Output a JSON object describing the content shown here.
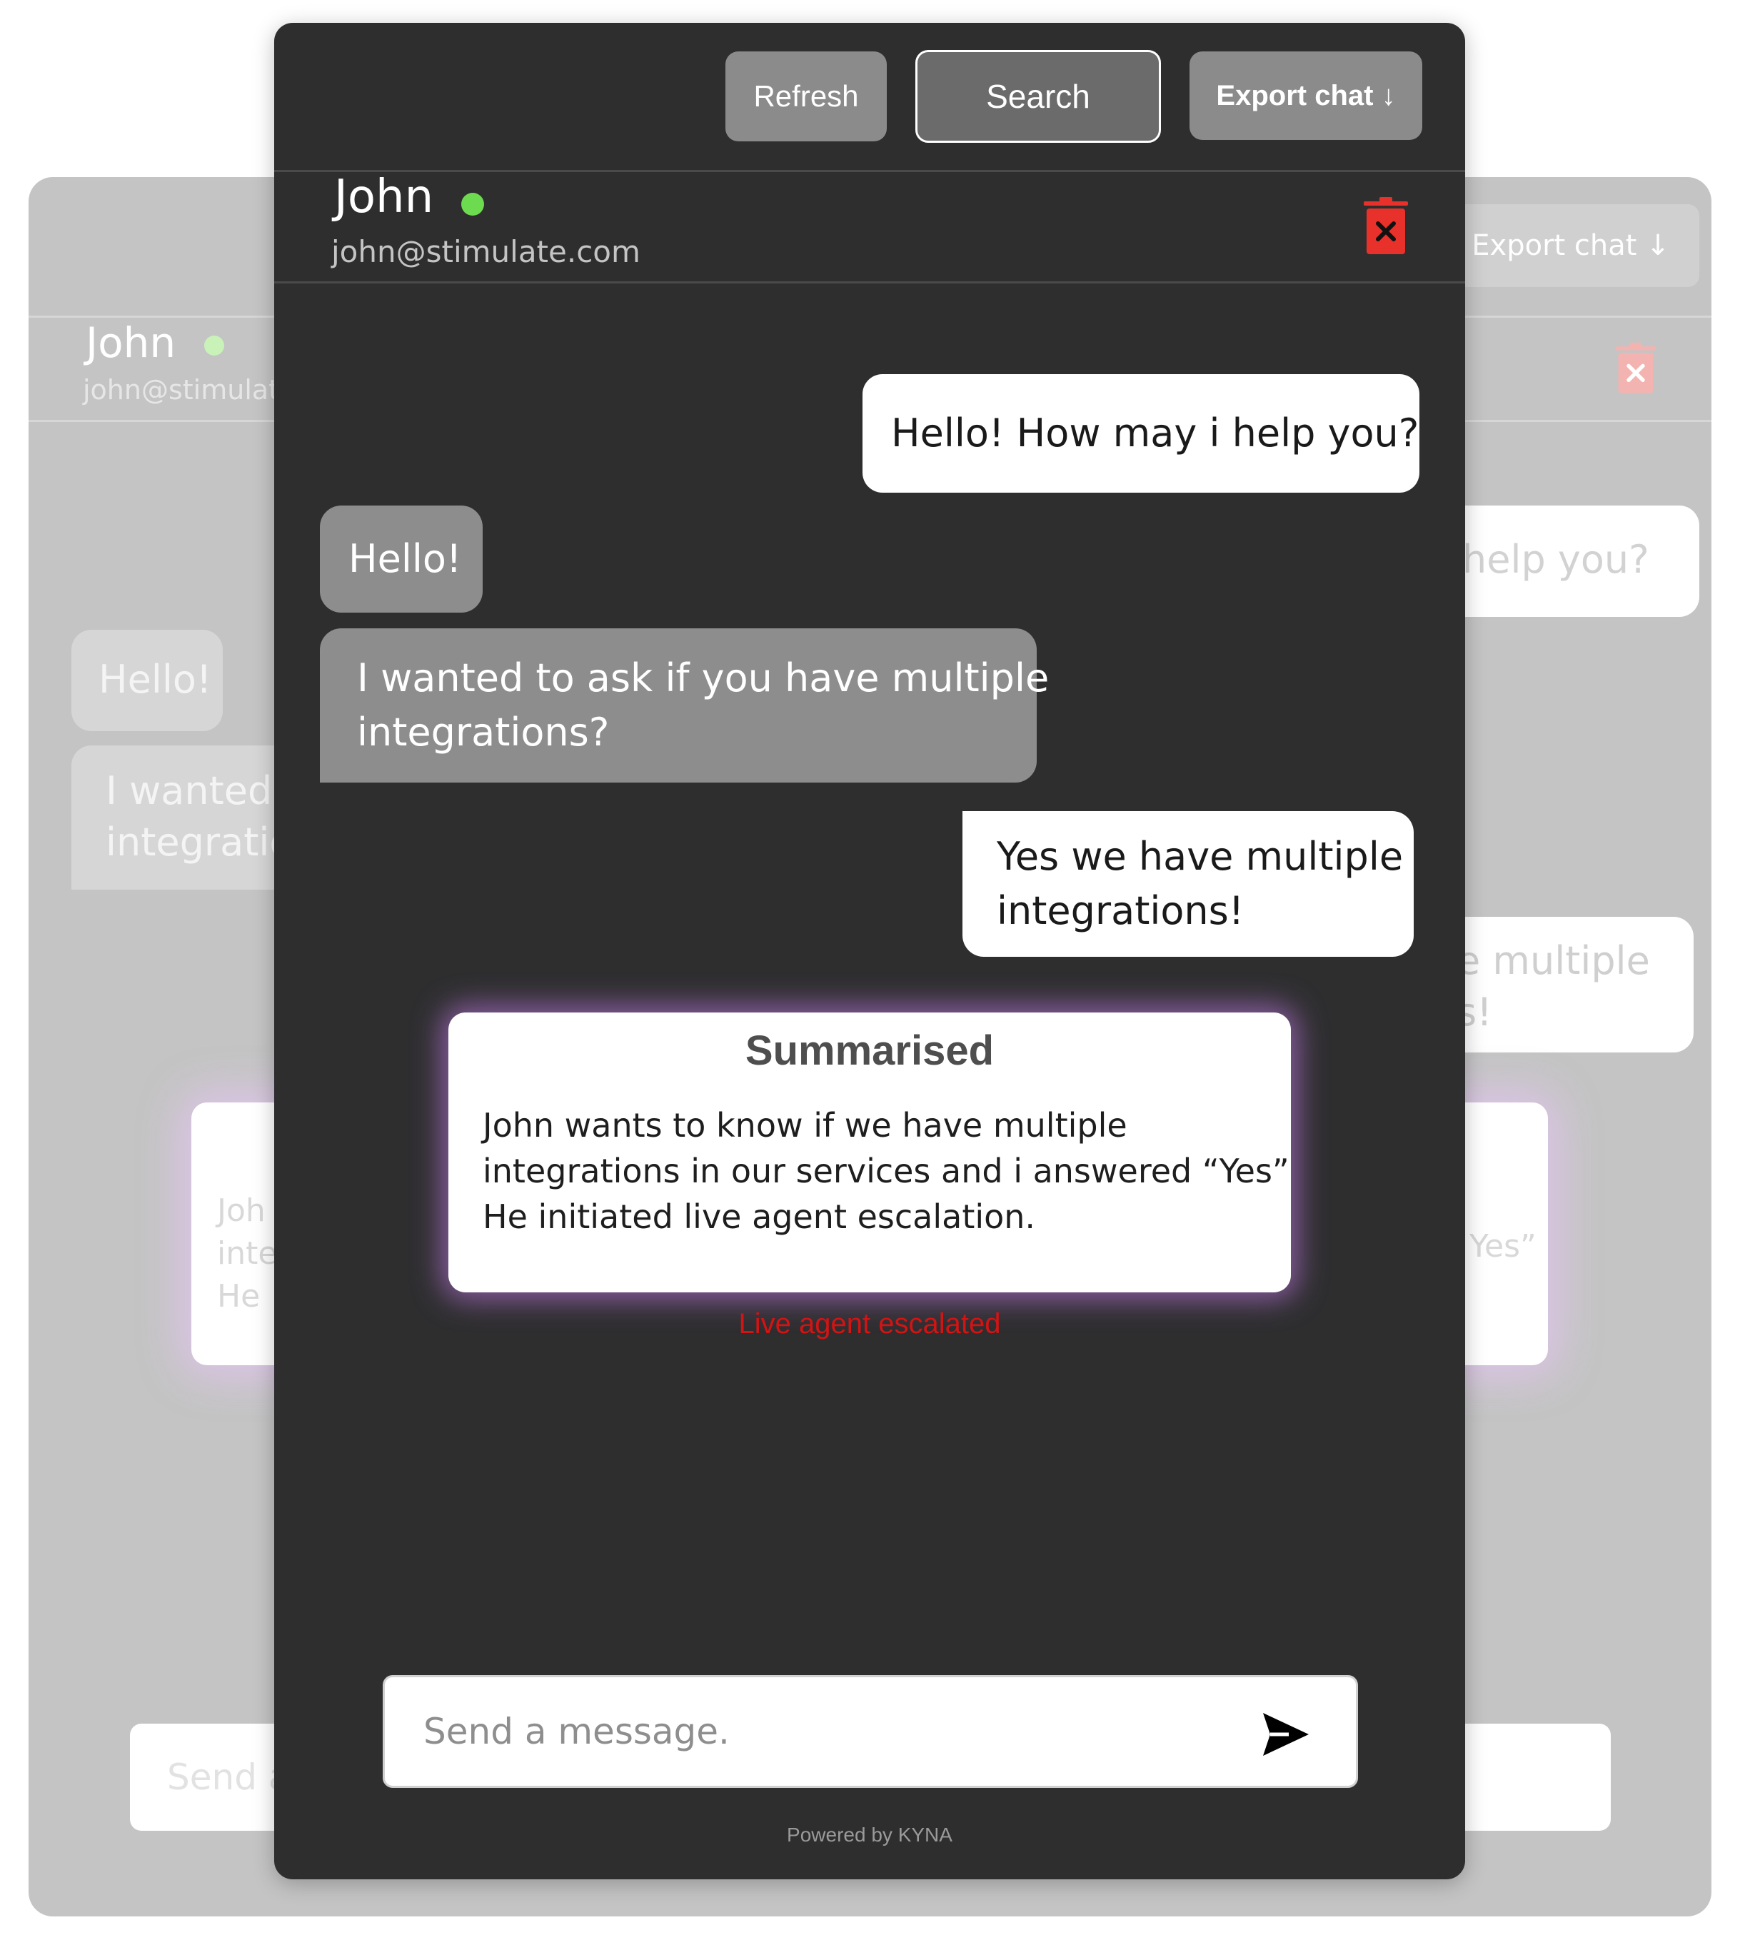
{
  "background_window": {
    "export_label": "Export chat ↓",
    "contact_name": "John",
    "contact_email": "john@stimulate.com",
    "bot_greeting_fragment": "help you?",
    "user_hello": "Hello!",
    "user_question_fragment": "I wanted t\nintegratio",
    "bot_reply_fragment": "e multiple\ns!",
    "summary_fragment": "Joh\ninte\nHe",
    "summary_quote_fragment": "Yes”",
    "input_fragment": "Send a"
  },
  "toolbar": {
    "refresh_label": "Refresh",
    "search_label": "Search",
    "export_label": "Export chat ↓"
  },
  "contact": {
    "name": "John",
    "email": "john@stimulate.com",
    "status": "online"
  },
  "messages": [
    {
      "from": "bot",
      "text": "Hello! How may i help you?"
    },
    {
      "from": "user",
      "text": "Hello!"
    },
    {
      "from": "user",
      "text": "I wanted to ask if you have multiple\nintegrations?"
    },
    {
      "from": "bot",
      "text": "Yes we have multiple\nintegrations!"
    }
  ],
  "summary": {
    "title": "Summarised",
    "body": "John wants to know if we have multiple\nintegrations in our services and i answered “Yes”\nHe initiated live agent escalation."
  },
  "escalation_status": "Live agent escalated",
  "composer": {
    "placeholder": "Send a message."
  },
  "footer": {
    "powered_by": "Powered by KYNA"
  },
  "colors": {
    "window_bg": "#2e2e2f",
    "online": "#6ddb4f",
    "delete": "#e8312a",
    "escalated": "#d41313",
    "summary_glow": "#aa6ec8"
  },
  "icons": [
    "trash-icon",
    "send-icon",
    "online-status-dot"
  ]
}
